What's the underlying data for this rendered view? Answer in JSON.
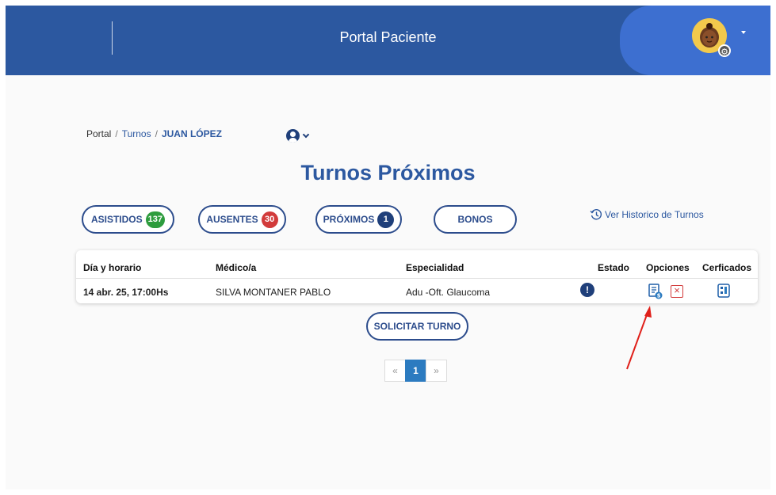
{
  "header": {
    "title": "Portal Paciente",
    "avatar_icon": "user-avatar-icon",
    "settings_icon": "gear-icon"
  },
  "breadcrumb": {
    "root": "Portal",
    "section": "Turnos",
    "current": "JUAN LÓPEZ",
    "separator": "/"
  },
  "page_title": "Turnos Próximos",
  "filters": [
    {
      "label": "ASISTIDOS",
      "count": "137",
      "badge_color": "#2e9c3e"
    },
    {
      "label": "AUSENTES",
      "count": "30",
      "badge_color": "#d23b3b"
    },
    {
      "label": "PRÓXIMOS",
      "count": "1",
      "badge_color": "#1f3f7a"
    },
    {
      "label": "BONOS"
    }
  ],
  "history_link": "Ver Historico de Turnos",
  "table": {
    "headers": {
      "date": "Día y horario",
      "doctor": "Médico/a",
      "specialty": "Especialidad",
      "status": "Estado",
      "options": "Opciones",
      "certificates": "Cerficados"
    },
    "rows": [
      {
        "date": "14 abr. 25, 17:00Hs",
        "doctor": "SILVA MONTANER PABLO",
        "specialty": "Adu -Oft. Glaucoma",
        "status_icon": "exclamation-icon",
        "option_icons": [
          "receipt-payment-icon",
          "cancel-x-icon"
        ],
        "certificate_icon": "certificate-icon"
      }
    ]
  },
  "request_button": "SOLICITAR TURNO",
  "pagination": {
    "prev": "«",
    "current_page": "1",
    "next": "»"
  },
  "colors": {
    "header_bg": "#2c58a0",
    "primary": "#2c58a0",
    "annotation_arrow": "#e0201a"
  }
}
